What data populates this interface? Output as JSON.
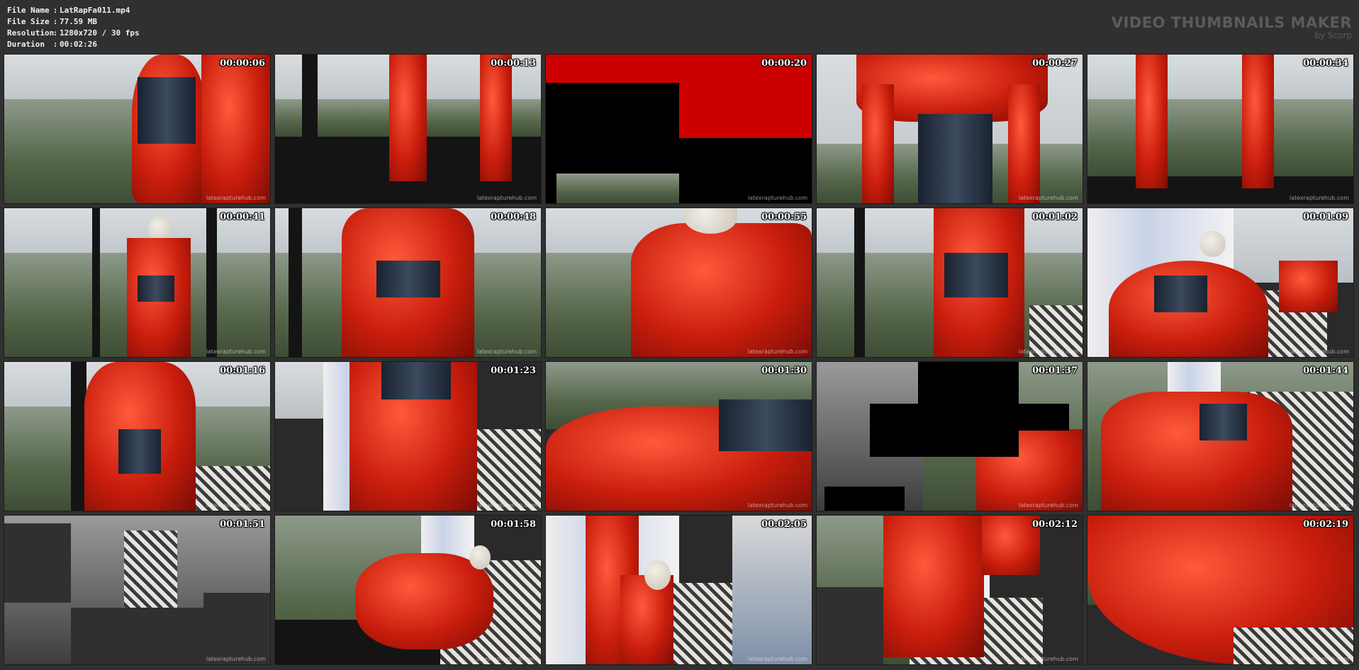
{
  "file_info": {
    "rows": [
      {
        "label": "File Name",
        "value": "LatRapFa011.mp4"
      },
      {
        "label": "File Size",
        "value": "77.59 MB"
      },
      {
        "label": "Resolution",
        "value": "1280x720 / 30 fps"
      },
      {
        "label": "Duration",
        "value": "00:02:26"
      }
    ],
    "separator": ":"
  },
  "brand": {
    "title": "VIDEO THUMBNAILS MAKER",
    "subtitle": "by Scorp"
  },
  "watermark": "latexrapturehub.com",
  "thumbnails": [
    {
      "time": "00:00:06"
    },
    {
      "time": "00:00:13"
    },
    {
      "time": "00:00:20"
    },
    {
      "time": "00:00:27"
    },
    {
      "time": "00:00:34"
    },
    {
      "time": "00:00:41"
    },
    {
      "time": "00:00:48"
    },
    {
      "time": "00:00:55"
    },
    {
      "time": "00:01:02"
    },
    {
      "time": "00:01:09"
    },
    {
      "time": "00:01:16"
    },
    {
      "time": "00:01:23"
    },
    {
      "time": "00:01:30"
    },
    {
      "time": "00:01:37"
    },
    {
      "time": "00:01:44"
    },
    {
      "time": "00:01:51"
    },
    {
      "time": "00:01:58"
    },
    {
      "time": "00:02:05"
    },
    {
      "time": "00:02:12"
    },
    {
      "time": "00:02:19"
    }
  ],
  "colors": {
    "background": "#303030",
    "latex_red": "#c81d0c",
    "brand_gray": "#5b5b5b"
  }
}
